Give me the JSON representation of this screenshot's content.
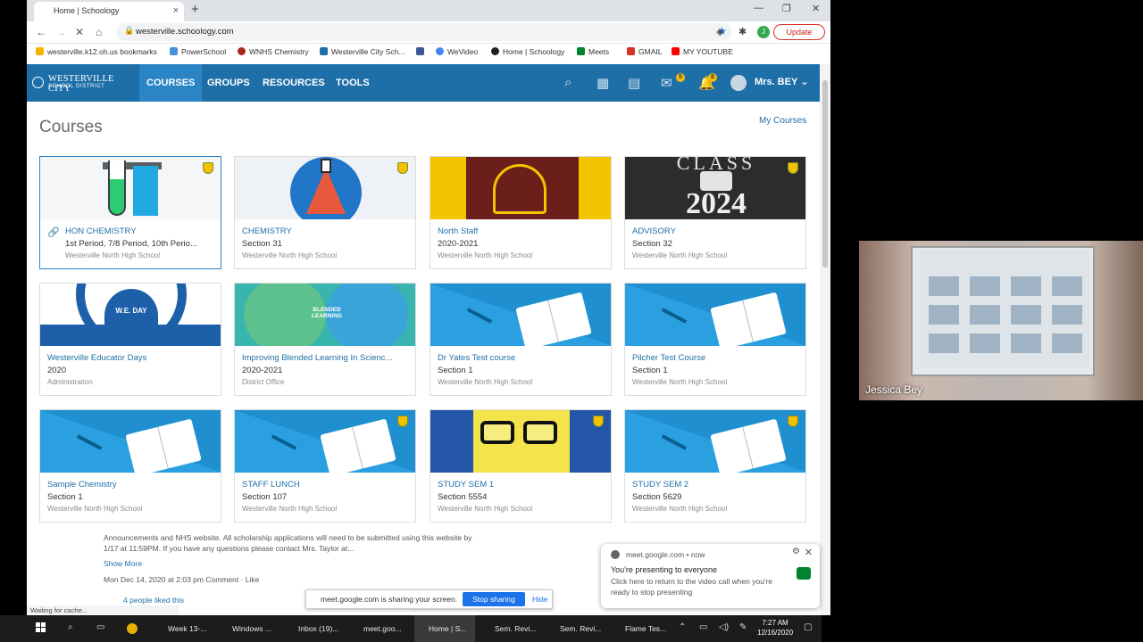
{
  "browser": {
    "tab_title": "Home | Schoology",
    "url": "westerville.schoology.com",
    "update_label": "Update",
    "profile_initial": "J",
    "bookmarks": [
      "westerville.k12.oh.us bookmarks",
      "PowerSchool",
      "WNHS Chemistry",
      "Westerville City Sch...",
      "WeVideo",
      "Home | Schoology",
      "Meets",
      "GMAIL",
      "MY YOUTUBE"
    ],
    "status_text": "Waiting for cache..."
  },
  "header": {
    "logo_line1": "WESTERVILLE CITY",
    "logo_line2": "SCHOOL DISTRICT",
    "nav": [
      "COURSES",
      "GROUPS",
      "RESOURCES",
      "TOOLS"
    ],
    "messages_badge": "5",
    "notifications_badge": "8",
    "user_name": "Mrs. BEY"
  },
  "page": {
    "title": "Courses",
    "my_courses_link": "My Courses"
  },
  "courses": [
    {
      "name": "HON CHEMISTRY",
      "section": "1st Period, 7/8 Period, 10th Perio...",
      "school": "Westerville North High School"
    },
    {
      "name": "CHEMISTRY",
      "section": "Section 31",
      "school": "Westerville North High School"
    },
    {
      "name": "North Staff",
      "section": "2020-2021",
      "school": "Westerville North High School"
    },
    {
      "name": "ADVISORY",
      "section": "Section 32",
      "school": "Westerville North High School"
    },
    {
      "name": "Westerville Educator Days",
      "section": "2020",
      "school": "Administration"
    },
    {
      "name": "Improving Blended Learning In Scienc...",
      "section": "2020-2021",
      "school": "District Office"
    },
    {
      "name": "Dr Yates Test course",
      "section": "Section 1",
      "school": "Westerville North High School"
    },
    {
      "name": "Pilcher Test Course",
      "section": "Section 1",
      "school": "Westerville North High School"
    },
    {
      "name": "Sample Chemistry",
      "section": "Section 1",
      "school": "Westerville North High School"
    },
    {
      "name": "STAFF LUNCH",
      "section": "Section 107",
      "school": "Westerville North High School"
    },
    {
      "name": "STUDY SEM 1",
      "section": "Section 5554",
      "school": "Westerville North High School"
    },
    {
      "name": "STUDY SEM 2",
      "section": "Section 5629",
      "school": "Westerville North High School"
    }
  ],
  "course_images": {
    "advisory_line1": "CLASS",
    "advisory_year": "2024",
    "educator_day": "W.E. DAY",
    "blended": "BLENDED LEARNING"
  },
  "post": {
    "line1": "Announcements and NHS website.  All scholarship applications will need to be submitted using this website by",
    "line2": "1/17 at 11:59PM. If you have any questions please contact Mrs. Taylor at...",
    "show_more": "Show More",
    "meta": "Mon Dec 14, 2020 at 2:03 pm  Comment · Like",
    "likes": "4 people liked this"
  },
  "share_bar": {
    "message": "meet.google.com is sharing your screen.",
    "stop_label": "Stop sharing",
    "hide_label": "Hide"
  },
  "notification": {
    "source": "meet.google.com • now",
    "title": "You're presenting to everyone",
    "body": "Click here to return to the video call when you're ready to stop presenting"
  },
  "taskbar": {
    "items": [
      "Week 13-...",
      "Windows ...",
      "Inbox (19)...",
      "meet.goo...",
      "Home | S...",
      "Sem. Revi...",
      "Sem. Revi...",
      "Flame Tes..."
    ],
    "time": "7:27 AM",
    "date": "12/16/2020"
  },
  "video": {
    "participant_name": "Jessica Bey"
  },
  "colors": {
    "schoology_blue": "#1e6fa8",
    "accent_link": "#1e6fa8",
    "stop_button": "#1a73e8"
  }
}
